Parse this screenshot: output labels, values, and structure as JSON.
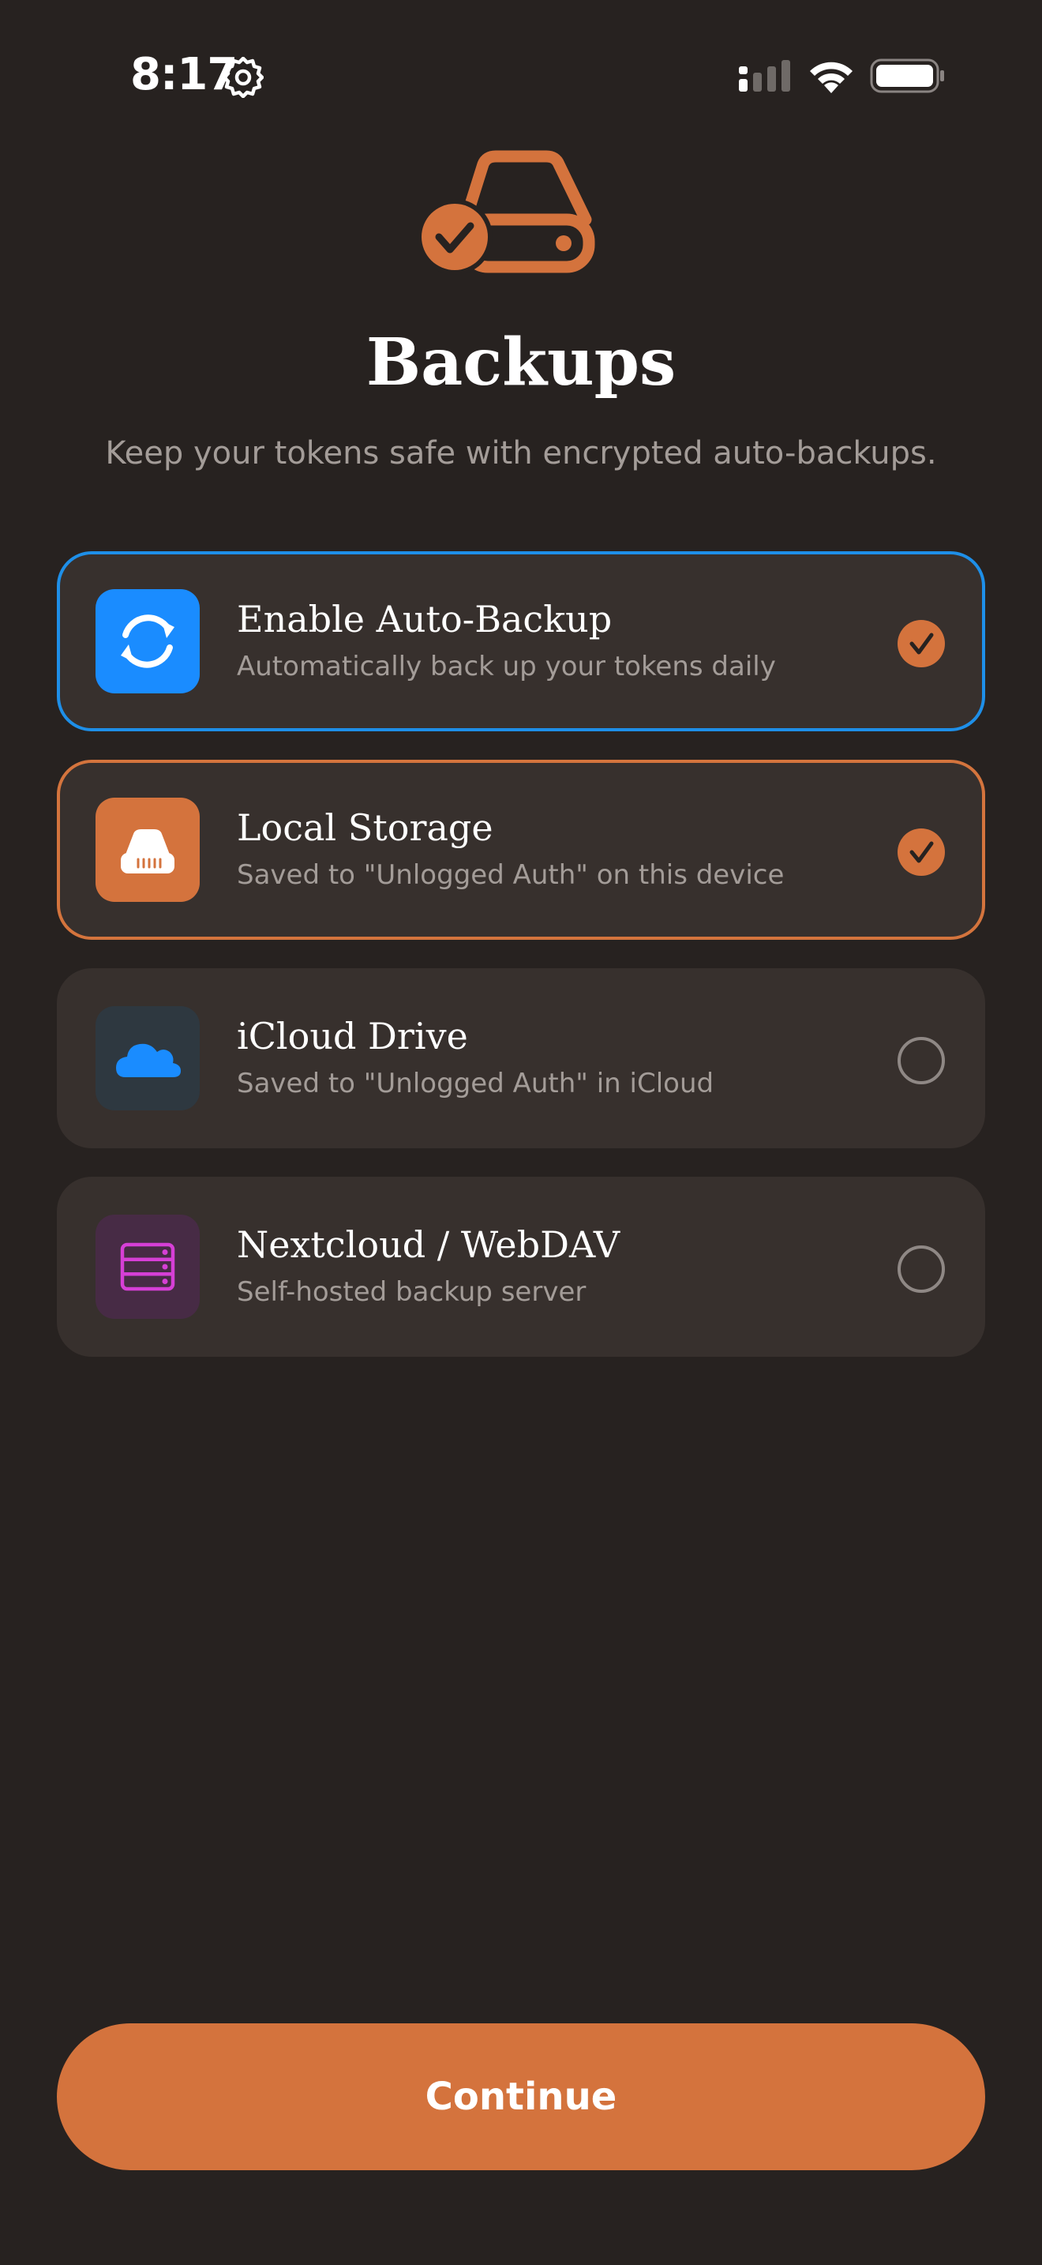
{
  "status_bar": {
    "time": "8:17",
    "icons": [
      "gear-icon",
      "cellular-signal-icon",
      "wifi-icon",
      "battery-icon"
    ]
  },
  "hero": {
    "icon": "hard-drive-check-icon",
    "title": "Backups",
    "subtitle": "Keep your tokens safe with encrypted auto-backups."
  },
  "options": [
    {
      "title": "Enable Auto-Backup",
      "description": "Automatically back up your tokens daily",
      "icon": "sync-arrows-icon",
      "selected": true
    },
    {
      "title": "Local Storage",
      "description": "Saved to \"Unlogged Auth\" on this device",
      "icon": "local-drive-icon",
      "selected": true
    },
    {
      "title": "iCloud Drive",
      "description": "Saved to \"Unlogged Auth\" in iCloud",
      "icon": "cloud-icon",
      "selected": false
    },
    {
      "title": "Nextcloud / WebDAV",
      "description": "Self-hosted backup server",
      "icon": "server-icon",
      "selected": false
    }
  ],
  "continue_label": "Continue",
  "colors": {
    "background": "#272220",
    "card": "#37302d",
    "accent": "#d4733d",
    "auto_backup_border": "#1e8fe8",
    "icloud_blue": "#1a8cff",
    "nextcloud_magenta": "#d63fd6",
    "muted_text": "#a39c98"
  }
}
